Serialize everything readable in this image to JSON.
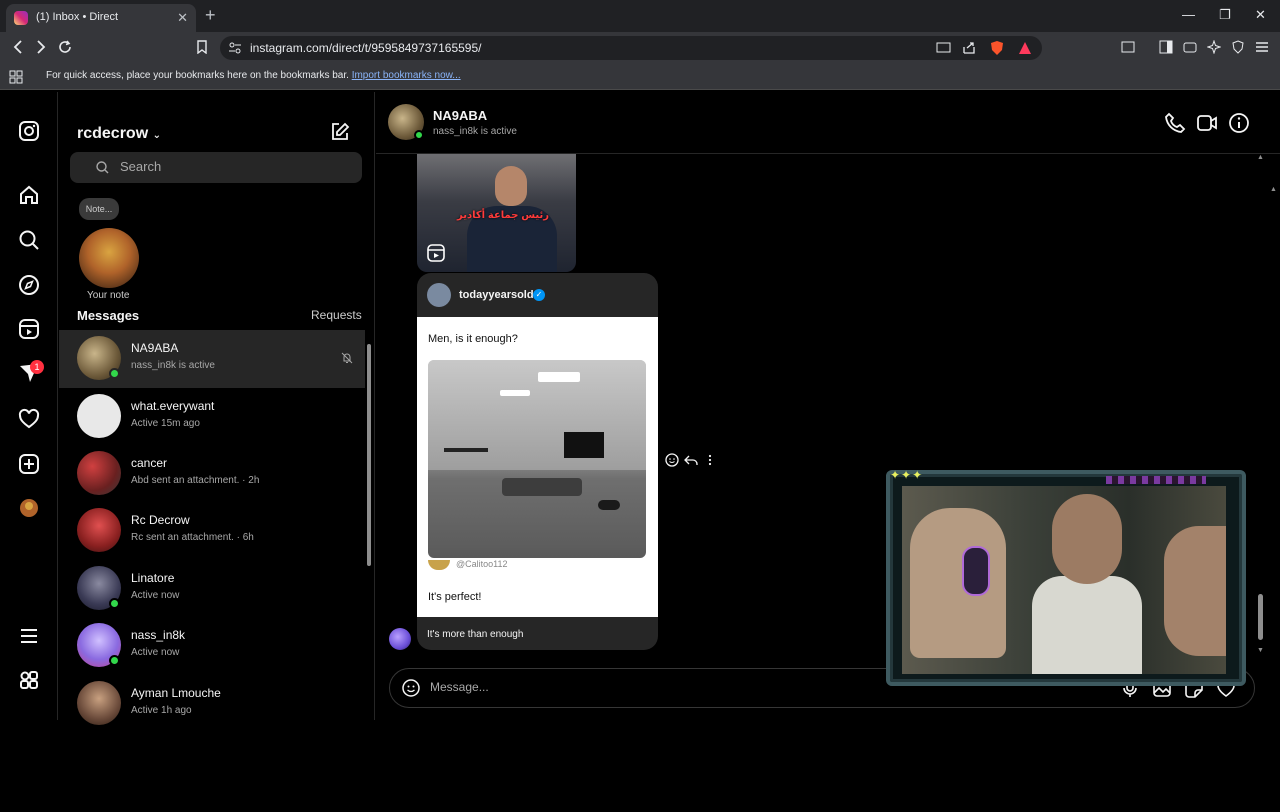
{
  "browser": {
    "tab_title": "(1) Inbox • Direct",
    "url": "instagram.com/direct/t/9595849737165595/",
    "bookmarks_text": "For quick access, place your bookmarks here on the bookmarks bar.",
    "bookmarks_link": "Import bookmarks now..."
  },
  "rail": {
    "notification_count": "1"
  },
  "sidebar": {
    "username": "rcdecrow",
    "search_placeholder": "Search",
    "note_bubble": "Note...",
    "note_label": "Your note",
    "messages_header": "Messages",
    "requests_label": "Requests",
    "conversations": [
      {
        "name": "NA9ABA",
        "sub": "nass_in8k is active",
        "active": true,
        "online": true,
        "color": "#8a7a5a"
      },
      {
        "name": "what.everywant",
        "sub": "Active 15m ago",
        "active": false,
        "online": false,
        "color": "#e8e8e8"
      },
      {
        "name": "cancer",
        "sub": "Abd sent an attachment. · 2h",
        "active": false,
        "online": false,
        "color": "#a03030"
      },
      {
        "name": "Rc Decrow",
        "sub": "Rc sent an attachment. · 6h",
        "active": false,
        "online": false,
        "color": "#c23a3a"
      },
      {
        "name": "Linatore",
        "sub": "Active now",
        "active": false,
        "online": true,
        "color": "#4a4a6a"
      },
      {
        "name": "nass_in8k",
        "sub": "Active now",
        "active": false,
        "online": true,
        "color": "#8a7ad8"
      },
      {
        "name": "Ayman Lmouche",
        "sub": "Active 1h ago",
        "active": false,
        "online": false,
        "color": "#6a4a3a"
      }
    ]
  },
  "chat": {
    "name": "NA9ABA",
    "status": "nass_in8k is active",
    "reel_overlay_text": "رئيس جماعة أكادير",
    "post": {
      "username": "todayyearsold",
      "text1": "Men, is it enough?",
      "handle": "@Calitoo112",
      "text2": "It's perfect!",
      "caption": "It's more than enough"
    },
    "composer_placeholder": "Message..."
  },
  "colors": {
    "background": "#000000",
    "online": "#32d74b",
    "badge": "#ff3040",
    "verified": "#0095f6"
  }
}
